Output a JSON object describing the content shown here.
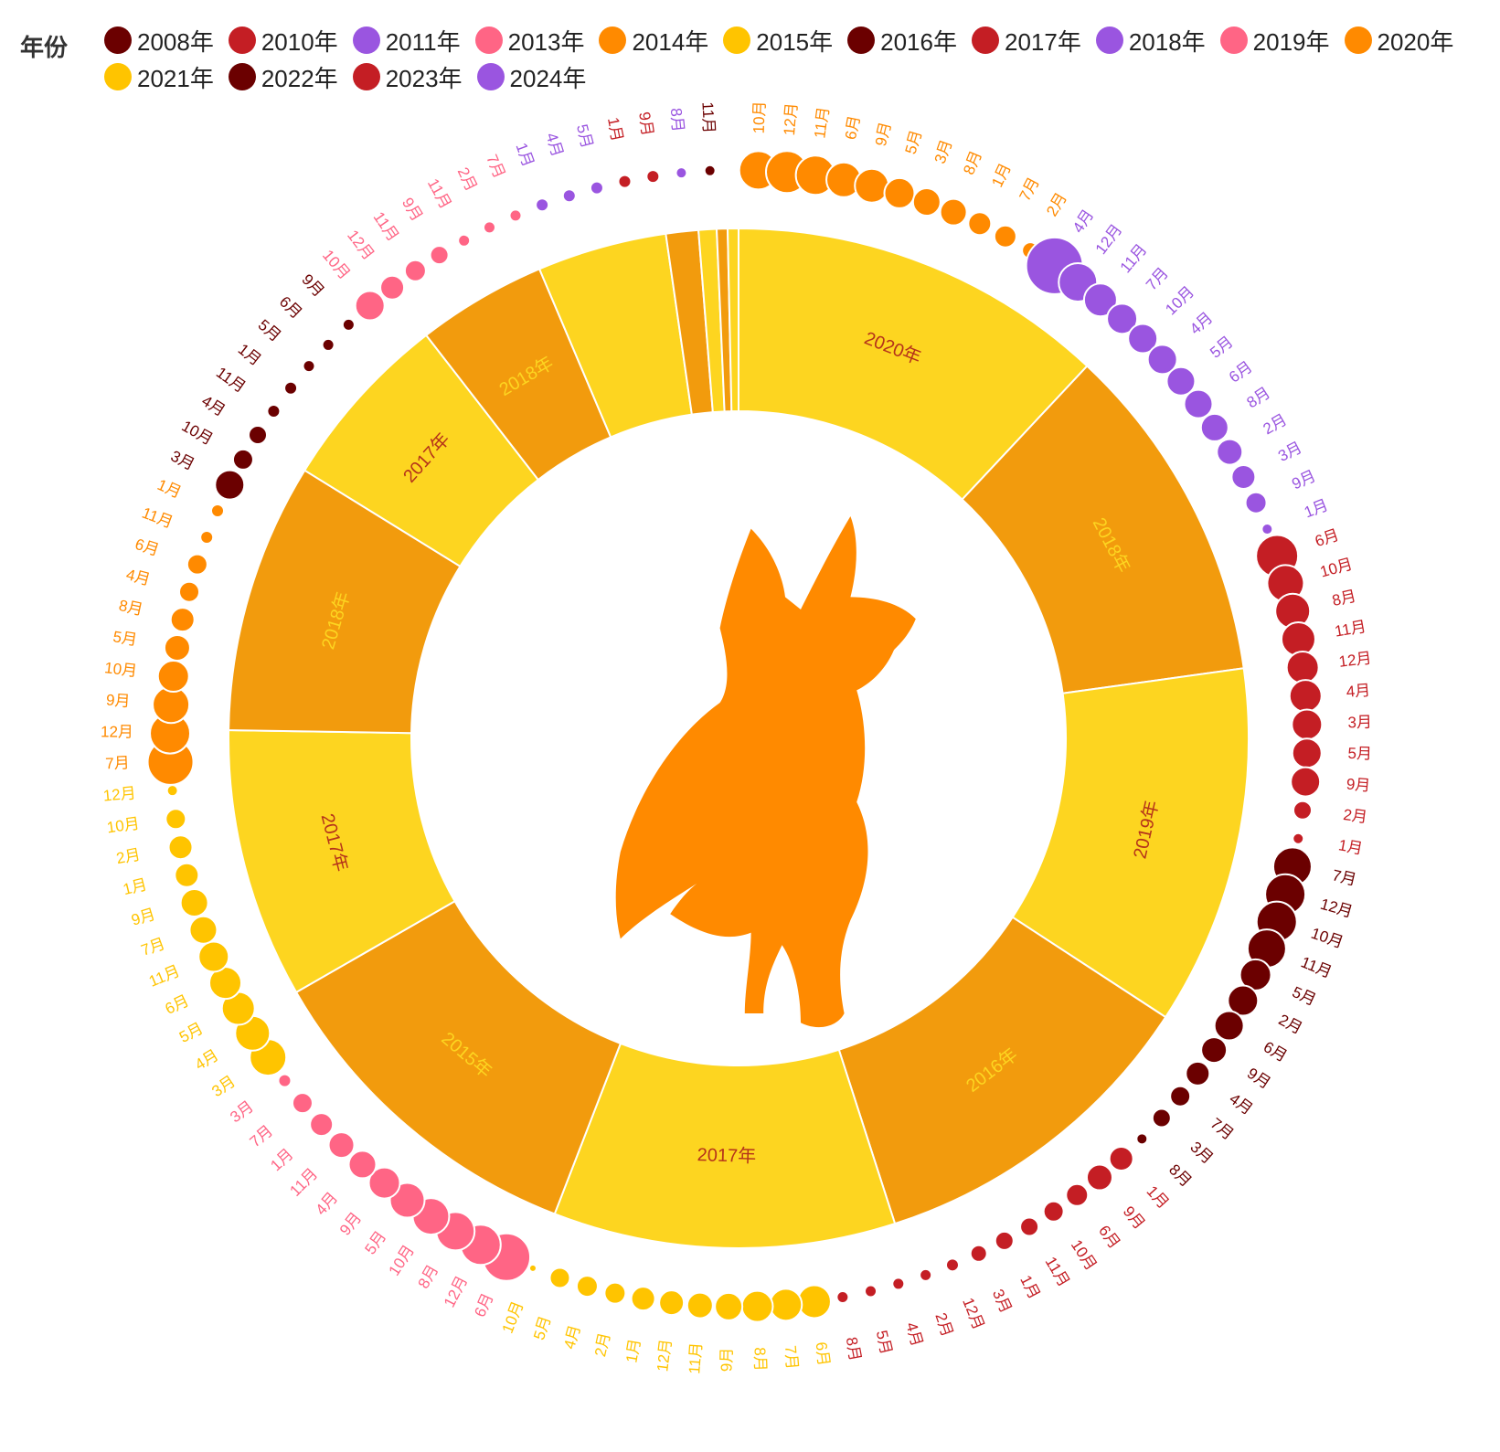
{
  "legend": {
    "title": "年份",
    "items": [
      {
        "label": "2008年",
        "color": "#6b0000"
      },
      {
        "label": "2010年",
        "color": "#c41e24"
      },
      {
        "label": "2011年",
        "color": "#9a55e0"
      },
      {
        "label": "2013年",
        "color": "#ff6585"
      },
      {
        "label": "2014年",
        "color": "#ff8a00"
      },
      {
        "label": "2015年",
        "color": "#ffc400"
      },
      {
        "label": "2016年",
        "color": "#6b0000"
      },
      {
        "label": "2017年",
        "color": "#c41e24"
      },
      {
        "label": "2018年",
        "color": "#9a55e0"
      },
      {
        "label": "2019年",
        "color": "#ff6585"
      },
      {
        "label": "2020年",
        "color": "#ff8a00"
      },
      {
        "label": "2021年",
        "color": "#ffc400"
      },
      {
        "label": "2022年",
        "color": "#6b0000"
      },
      {
        "label": "2023年",
        "color": "#c41e24"
      },
      {
        "label": "2024年",
        "color": "#9a55e0"
      }
    ]
  },
  "center_icon": "dog-silhouette-icon",
  "colors": {
    "light": "#fdd520",
    "dark": "#f29b0d",
    "label_on_light": "#b5331a",
    "label_on_dark": "#fdd520",
    "dog": "#ff8a00"
  },
  "chart_data": [
    {
      "type": "pie",
      "subtype": "ring",
      "segments": [
        {
          "label": "2020年",
          "value": 10.5,
          "show_label": true,
          "shade": "light"
        },
        {
          "label": "2018年",
          "value": 9.5,
          "show_label": true,
          "shade": "dark"
        },
        {
          "label": "2019年",
          "value": 10.0,
          "show_label": true,
          "shade": "light"
        },
        {
          "label": "2016年",
          "value": 9.5,
          "show_label": true,
          "shade": "dark"
        },
        {
          "label": "2017年",
          "value": 9.5,
          "show_label": true,
          "shade": "light"
        },
        {
          "label": "2015年",
          "value": 9.5,
          "show_label": true,
          "shade": "dark"
        },
        {
          "label": "2017年",
          "value": 7.5,
          "show_label": true,
          "shade": "light"
        },
        {
          "label": "2018年",
          "value": 7.5,
          "show_label": true,
          "shade": "dark"
        },
        {
          "label": "2017年",
          "value": 5.0,
          "show_label": true,
          "shade": "light"
        },
        {
          "label": "2018年",
          "value": 3.6,
          "show_label": true,
          "shade": "dark"
        },
        {
          "label": "",
          "value": 3.6,
          "show_label": false,
          "shade": "light"
        },
        {
          "label": "",
          "value": 0.9,
          "show_label": false,
          "shade": "dark"
        },
        {
          "label": "",
          "value": 0.5,
          "show_label": false,
          "shade": "light"
        },
        {
          "label": "",
          "value": 0.3,
          "show_label": false,
          "shade": "dark"
        },
        {
          "label": "",
          "value": 0.3,
          "show_label": false,
          "shade": "light"
        }
      ]
    },
    {
      "type": "scatter",
      "subtype": "radial-bubbles",
      "groups": [
        {
          "year": "2020年",
          "color": "#ff8a00",
          "points": [
            {
              "month": "10月",
              "size": 42
            },
            {
              "month": "12月",
              "size": 46
            },
            {
              "month": "11月",
              "size": 43
            },
            {
              "month": "6月",
              "size": 38
            },
            {
              "month": "9月",
              "size": 37
            },
            {
              "month": "5月",
              "size": 33
            },
            {
              "month": "3月",
              "size": 30
            },
            {
              "month": "8月",
              "size": 29
            },
            {
              "month": "1月",
              "size": 25
            },
            {
              "month": "7月",
              "size": 24
            },
            {
              "month": "2月",
              "size": 18
            }
          ]
        },
        {
          "year": "2018年",
          "color": "#9a55e0",
          "points": [
            {
              "month": "4月",
              "size": 62
            },
            {
              "month": "12月",
              "size": 42
            },
            {
              "month": "11月",
              "size": 36
            },
            {
              "month": "7月",
              "size": 33
            },
            {
              "month": "10月",
              "size": 32
            },
            {
              "month": "4月",
              "size": 32
            },
            {
              "month": "5月",
              "size": 31
            },
            {
              "month": "6月",
              "size": 31
            },
            {
              "month": "8月",
              "size": 30
            },
            {
              "month": "2月",
              "size": 28
            },
            {
              "month": "3月",
              "size": 26
            },
            {
              "month": "9月",
              "size": 23
            },
            {
              "month": "1月",
              "size": 12
            }
          ]
        },
        {
          "year": "2017年",
          "color": "#c41e24",
          "points": [
            {
              "month": "6月",
              "size": 46
            },
            {
              "month": "10月",
              "size": 40
            },
            {
              "month": "8月",
              "size": 38
            },
            {
              "month": "11月",
              "size": 37
            },
            {
              "month": "12月",
              "size": 35
            },
            {
              "month": "4月",
              "size": 35
            },
            {
              "month": "3月",
              "size": 33
            },
            {
              "month": "5月",
              "size": 32
            },
            {
              "month": "9月",
              "size": 32
            },
            {
              "month": "2月",
              "size": 20
            },
            {
              "month": "1月",
              "size": 12
            }
          ]
        },
        {
          "year": "2016年",
          "color": "#6b0000",
          "points": [
            {
              "month": "7月",
              "size": 42
            },
            {
              "month": "12月",
              "size": 44
            },
            {
              "month": "10月",
              "size": 44
            },
            {
              "month": "11月",
              "size": 42
            },
            {
              "month": "5月",
              "size": 34
            },
            {
              "month": "2月",
              "size": 33
            },
            {
              "month": "6月",
              "size": 32
            },
            {
              "month": "9月",
              "size": 28
            },
            {
              "month": "4月",
              "size": 26
            },
            {
              "month": "7月",
              "size": 22
            },
            {
              "month": "3月",
              "size": 20
            },
            {
              "month": "8月",
              "size": 12
            }
          ]
        },
        {
          "year": "2017年",
          "color": "#c41e24",
          "points": [
            {
              "month": "1月",
              "size": 26
            },
            {
              "month": "9月",
              "size": 28
            },
            {
              "month": "6月",
              "size": 24
            },
            {
              "month": "10月",
              "size": 22
            },
            {
              "month": "11月",
              "size": 20
            },
            {
              "month": "1月",
              "size": 20
            },
            {
              "month": "3月",
              "size": 18
            },
            {
              "month": "12月",
              "size": 14
            },
            {
              "month": "2月",
              "size": 13
            },
            {
              "month": "4月",
              "size": 13
            },
            {
              "month": "5月",
              "size": 13
            },
            {
              "month": "8月",
              "size": 13
            }
          ]
        },
        {
          "year": "2015年",
          "color": "#ffc400",
          "points": [
            {
              "month": "6月",
              "size": 36
            },
            {
              "month": "7月",
              "size": 35
            },
            {
              "month": "8月",
              "size": 34
            },
            {
              "month": "9月",
              "size": 30
            },
            {
              "month": "11月",
              "size": 28
            },
            {
              "month": "12月",
              "size": 27
            },
            {
              "month": "1月",
              "size": 26
            },
            {
              "month": "2月",
              "size": 23
            },
            {
              "month": "4月",
              "size": 23
            },
            {
              "month": "5月",
              "size": 22
            },
            {
              "month": "10月",
              "size": 8
            }
          ]
        },
        {
          "year": "2019年",
          "color": "#ff6585",
          "points": [
            {
              "month": "6月",
              "size": 52
            },
            {
              "month": "12月",
              "size": 44
            },
            {
              "month": "8月",
              "size": 42
            },
            {
              "month": "10月",
              "size": 40
            },
            {
              "month": "5月",
              "size": 38
            },
            {
              "month": "9月",
              "size": 34
            },
            {
              "month": "4月",
              "size": 30
            },
            {
              "month": "11月",
              "size": 28
            },
            {
              "month": "1月",
              "size": 25
            },
            {
              "month": "7月",
              "size": 22
            },
            {
              "month": "3月",
              "size": 14
            }
          ]
        },
        {
          "year": "2021年",
          "color": "#ffc400",
          "points": [
            {
              "month": "3月",
              "size": 40
            },
            {
              "month": "4月",
              "size": 38
            },
            {
              "month": "5月",
              "size": 36
            },
            {
              "month": "6月",
              "size": 35
            },
            {
              "month": "11月",
              "size": 33
            },
            {
              "month": "7月",
              "size": 30
            },
            {
              "month": "9月",
              "size": 30
            },
            {
              "month": "1月",
              "size": 26
            },
            {
              "month": "2月",
              "size": 26
            },
            {
              "month": "10月",
              "size": 22
            },
            {
              "month": "12月",
              "size": 12
            }
          ]
        },
        {
          "year": "2014年",
          "color": "#ff8a00",
          "points": [
            {
              "month": "7月",
              "size": 50
            },
            {
              "month": "12月",
              "size": 44
            },
            {
              "month": "9月",
              "size": 40
            },
            {
              "month": "10月",
              "size": 34
            },
            {
              "month": "5月",
              "size": 28
            },
            {
              "month": "8月",
              "size": 26
            },
            {
              "month": "4月",
              "size": 22
            },
            {
              "month": "6月",
              "size": 22
            },
            {
              "month": "11月",
              "size": 14
            },
            {
              "month": "1月",
              "size": 14
            }
          ]
        },
        {
          "year": "2022年",
          "color": "#6b0000",
          "points": [
            {
              "month": "3月",
              "size": 32
            },
            {
              "month": "10月",
              "size": 22
            },
            {
              "month": "4月",
              "size": 20
            },
            {
              "month": "11月",
              "size": 14
            },
            {
              "month": "1月",
              "size": 14
            },
            {
              "month": "5月",
              "size": 13
            },
            {
              "month": "6月",
              "size": 13
            },
            {
              "month": "9月",
              "size": 13
            }
          ]
        },
        {
          "year": "2013年",
          "color": "#ff6585",
          "points": [
            {
              "month": "10月",
              "size": 32
            },
            {
              "month": "12月",
              "size": 26
            },
            {
              "month": "11月",
              "size": 23
            },
            {
              "month": "9月",
              "size": 20
            },
            {
              "month": "11月",
              "size": 13
            },
            {
              "month": "2月",
              "size": 13
            },
            {
              "month": "7月",
              "size": 13
            }
          ]
        },
        {
          "year": "2011年",
          "color": "#9a55e0",
          "points": [
            {
              "month": "1月",
              "size": 14
            },
            {
              "month": "4月",
              "size": 14
            },
            {
              "month": "5月",
              "size": 14
            }
          ]
        },
        {
          "year": "2010年",
          "color": "#c41e24",
          "points": [
            {
              "month": "1月",
              "size": 14
            },
            {
              "month": "9月",
              "size": 14
            }
          ]
        },
        {
          "year": "2024年",
          "color": "#9a55e0",
          "points": [
            {
              "month": "8月",
              "size": 12
            }
          ]
        },
        {
          "year": "2008年",
          "color": "#6b0000",
          "points": [
            {
              "month": "11月",
              "size": 12
            }
          ]
        }
      ]
    }
  ]
}
